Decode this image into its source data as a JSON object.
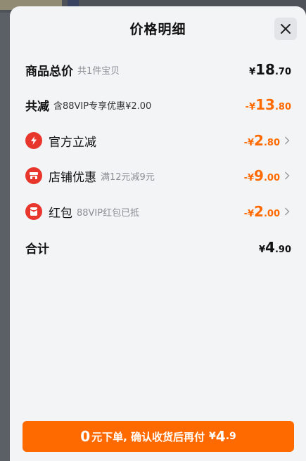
{
  "sheet": {
    "title": "价格明细",
    "close_icon": "close-icon"
  },
  "rows": {
    "goods_total": {
      "label": "商品总价",
      "sub": "共1件宝贝",
      "currency": "¥",
      "int": "18",
      "dec": ".70"
    },
    "total_reduce": {
      "label": "共减",
      "sub": "含88VIP专享优惠¥2.00",
      "currency": "-¥",
      "int": "13",
      "dec": ".80"
    },
    "official": {
      "icon": "lightning-icon",
      "label": "官方立减",
      "currency": "-¥",
      "int": "2",
      "dec": ".80"
    },
    "store": {
      "icon": "store-icon",
      "label": "店铺优惠",
      "sub": "满12元减9元",
      "currency": "-¥",
      "int": "9",
      "dec": ".00"
    },
    "redpacket": {
      "icon": "red-packet-icon",
      "label": "红包",
      "sub": "88VIP红包已抵",
      "currency": "-¥",
      "int": "2",
      "dec": ".00"
    },
    "sum": {
      "label": "合计",
      "currency": "¥",
      "int": "4",
      "dec": ".90"
    }
  },
  "cta": {
    "big": "0",
    "text": "元下单, 确认收货后再付",
    "currency": "¥",
    "price_int": "4",
    "price_dec": ".9"
  },
  "colors": {
    "accent": "#ff6a00",
    "icon_red": "#e8362d",
    "sheet_bg": "#f3f4f6"
  }
}
